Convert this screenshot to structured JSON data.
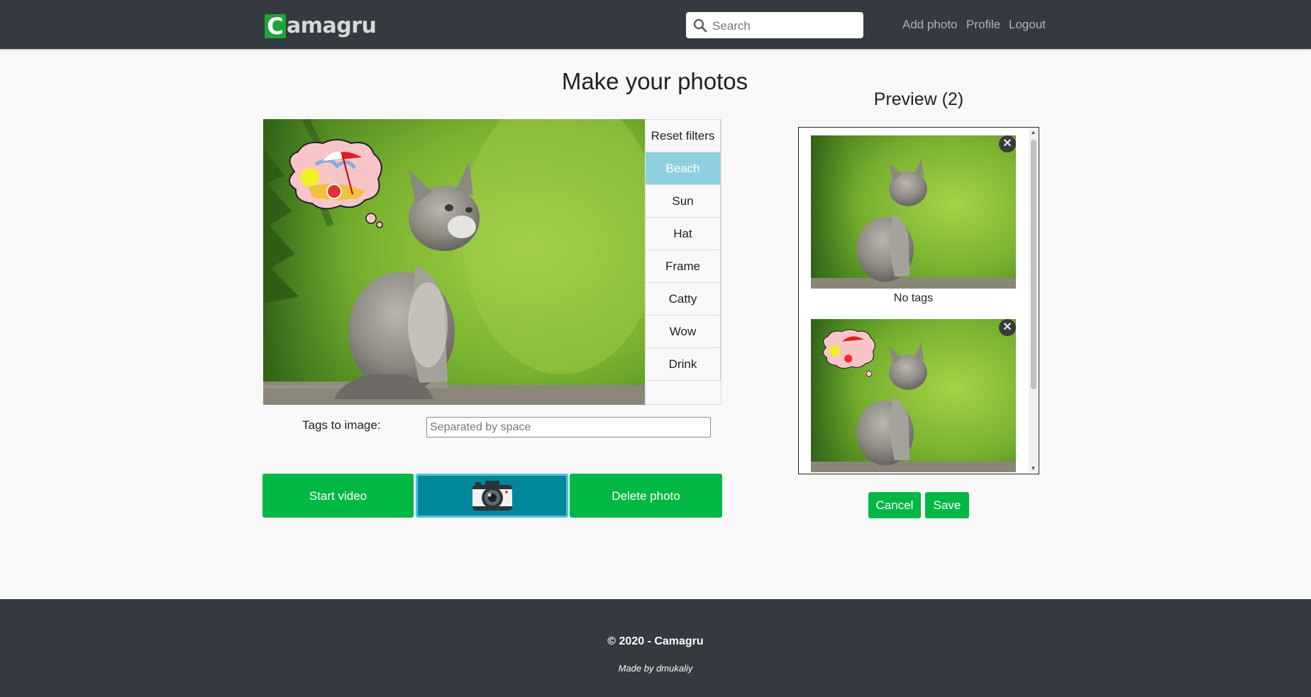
{
  "nav": {
    "logo_mark": "C",
    "logo_rest": "amagru",
    "search_placeholder": "Search",
    "links": [
      "Add photo",
      "Profile",
      "Logout"
    ]
  },
  "editor": {
    "title": "Make your photos",
    "filters": [
      "Reset filters",
      "Beach",
      "Sun",
      "Hat",
      "Frame",
      "Catty",
      "Wow",
      "Drink"
    ],
    "active_filter": "Beach",
    "tags_label": "Tags to image:",
    "tags_placeholder": "Separated by space",
    "start_video": "Start video",
    "capture_icon": "camera-icon",
    "delete_photo": "Delete photo"
  },
  "preview": {
    "title": "Preview (2)",
    "items": [
      {
        "caption": "No tags",
        "sticker": ""
      },
      {
        "caption": "",
        "sticker": "beach"
      }
    ],
    "cancel": "Cancel",
    "save": "Save"
  },
  "footer": {
    "copyright": "© 2020 - Camagru",
    "made_by": "Made by dmukaliy"
  },
  "colors": {
    "navbar": "#343a40",
    "primary_button": "#00b843",
    "capture_button": "#00879a",
    "active_filter": "#8fd0e0"
  }
}
